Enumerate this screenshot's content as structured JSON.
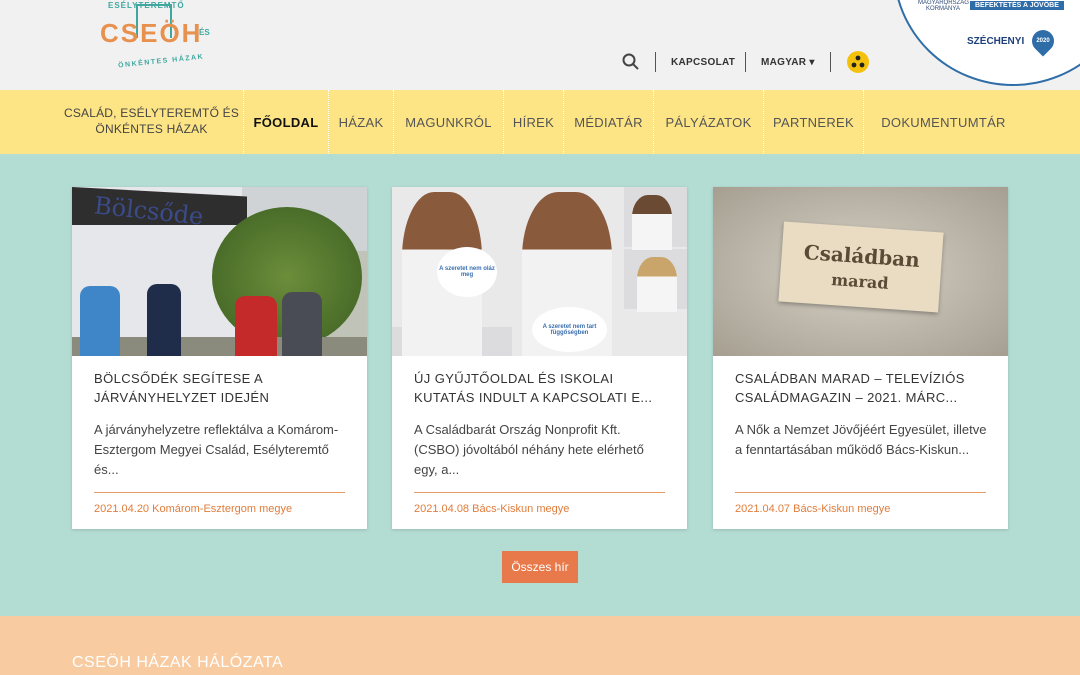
{
  "header": {
    "logo_word": "CSEÖH",
    "logo_top_arc": "CSALÁD, ESÉLYTEREMTŐ",
    "logo_es": "ÉS",
    "logo_bottom_arc": "ÖNKÉNTES HÁZAK",
    "contact_label": "KAPCSOLAT",
    "language_label": "MAGYAR ▾",
    "gov_text": "MAGYARORSZÁG KORMÁNYA",
    "gov_banner": "BEFEKTETÉS A JÖVŐBE",
    "szechenyi": "SZÉCHENYI",
    "szechenyi_year": "2020"
  },
  "nav": {
    "brand": "CSALÁD, ESÉLYTEREMTŐ ÉS ÖNKÉNTES HÁZAK",
    "items": [
      {
        "label": "FŐOLDAL",
        "active": true
      },
      {
        "label": "HÁZAK"
      },
      {
        "label": "MAGUNKRÓL"
      },
      {
        "label": "HÍREK"
      },
      {
        "label": "MÉDIATÁR"
      },
      {
        "label": "PÁLYÁZATOK"
      },
      {
        "label": "PARTNEREK"
      },
      {
        "label": "DOKUMENTUMTÁR"
      }
    ]
  },
  "news": [
    {
      "title": "BÖLCSŐDÉK SEGÍTESE A JÁRVÁNYHELYZET IDEJÉN",
      "excerpt": "A járványhelyzetre reflektálva a Komárom-Esztergom Megyei Család, Esélyteremtő és...",
      "date": "2021.04.20",
      "region": "Komárom-Esztergom megye",
      "image_text": "Bölcsőde"
    },
    {
      "title": "ÚJ GYŰJTŐOLDAL ÉS ISKOLAI KUTATÁS INDULT A KAPCSOLATI E...",
      "excerpt": "A Családbarát Ország Nonprofit Kft. (CSBO) jóvoltából néhány hete elérhető egy, a...",
      "date": "2021.04.08",
      "region": "Bács-Kiskun megye",
      "image_heart1": "A szeretet nem oláz meg",
      "image_heart2": "A szeretet nem tart függőségben"
    },
    {
      "title": "CSALÁDBAN MARAD – TELEVÍZIÓS CSALÁDMAGAZIN – 2021. MÁRC...",
      "excerpt": "A Nők a Nemzet Jövőjéért Egyesület, illetve a fenntartásában működő Bács-Kiskun...",
      "date": "2021.04.07",
      "region": "Bács-Kiskun megye",
      "image_line1": "Családban",
      "image_line2": "marad"
    }
  ],
  "all_news_button": "Összes hír",
  "footer": {
    "heading": "CSEÖH HÁZAK HÁLÓZATA"
  },
  "colors": {
    "nav_bg": "#fde586",
    "main_bg": "#b3dcd3",
    "accent": "#e8794a",
    "footer_bg": "#f8cba0"
  }
}
